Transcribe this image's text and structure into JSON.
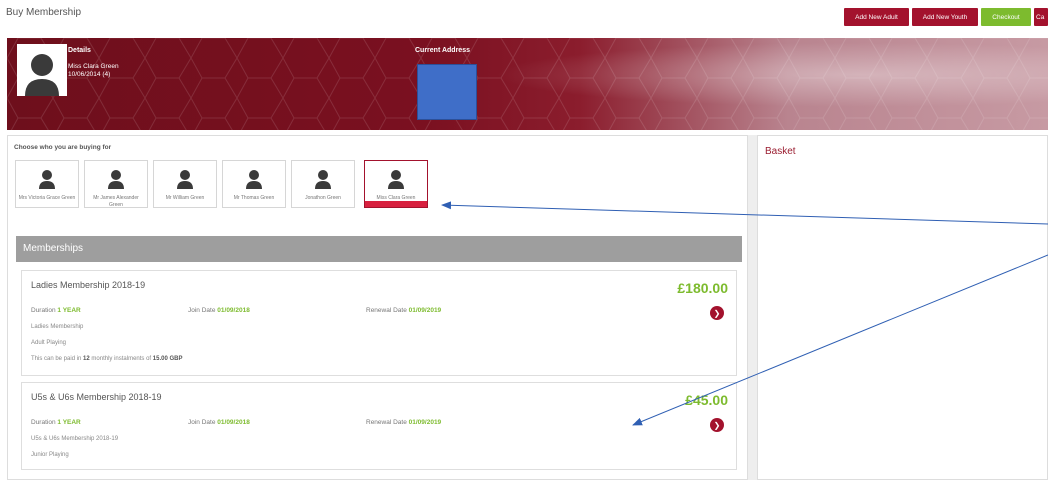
{
  "header": {
    "title": "Buy Membership",
    "buttons": {
      "add_adult": "Add New Adult",
      "add_youth": "Add New Youth",
      "checkout": "Checkout",
      "cancel": "Ca"
    }
  },
  "hero": {
    "details_label": "Details",
    "member_name": "Miss Clara Green",
    "member_dob": "10/06/2014 (4)",
    "address_label": "Current Address"
  },
  "chooser": {
    "label": "Choose who you are buying for",
    "members": [
      {
        "name": "Mrs Victoria Grace Green"
      },
      {
        "name": "Mr James Alexander Green"
      },
      {
        "name": "Mr William Green"
      },
      {
        "name": "Mr Thomas Green"
      },
      {
        "name": "Jonathon Green"
      },
      {
        "name": "Miss Clara Green"
      }
    ],
    "selected_index": 5
  },
  "memberships": {
    "header": "Memberships",
    "items": [
      {
        "title": "Ladies Membership 2018-19",
        "price": "£180.00",
        "duration_label": "Duration",
        "duration": "1 YEAR",
        "join_label": "Join Date",
        "join_date": "01/09/2018",
        "renewal_label": "Renewal Date",
        "renewal_date": "01/09/2019",
        "line1": "Ladies Membership",
        "line2": "Adult Playing",
        "instalment_prefix": "This can be paid in",
        "instalment_count": "12",
        "instalment_mid": "monthly instalments of",
        "instalment_amount": "15.00 GBP"
      },
      {
        "title": "U5s & U6s Membership 2018-19",
        "price": "£45.00",
        "duration_label": "Duration",
        "duration": "1 YEAR",
        "join_label": "Join Date",
        "join_date": "01/09/2018",
        "renewal_label": "Renewal Date",
        "renewal_date": "01/09/2019",
        "line1": "U5s & U6s Membership 2018-19",
        "line2": "Junior Playing"
      }
    ]
  },
  "basket": {
    "title": "Basket"
  },
  "colors": {
    "brand_red": "#a3122d",
    "accent_green": "#7dbb2e",
    "annotation_blue": "#2f5fb3"
  },
  "icons": {
    "person": "person-icon",
    "go": "chevron-right-icon"
  }
}
